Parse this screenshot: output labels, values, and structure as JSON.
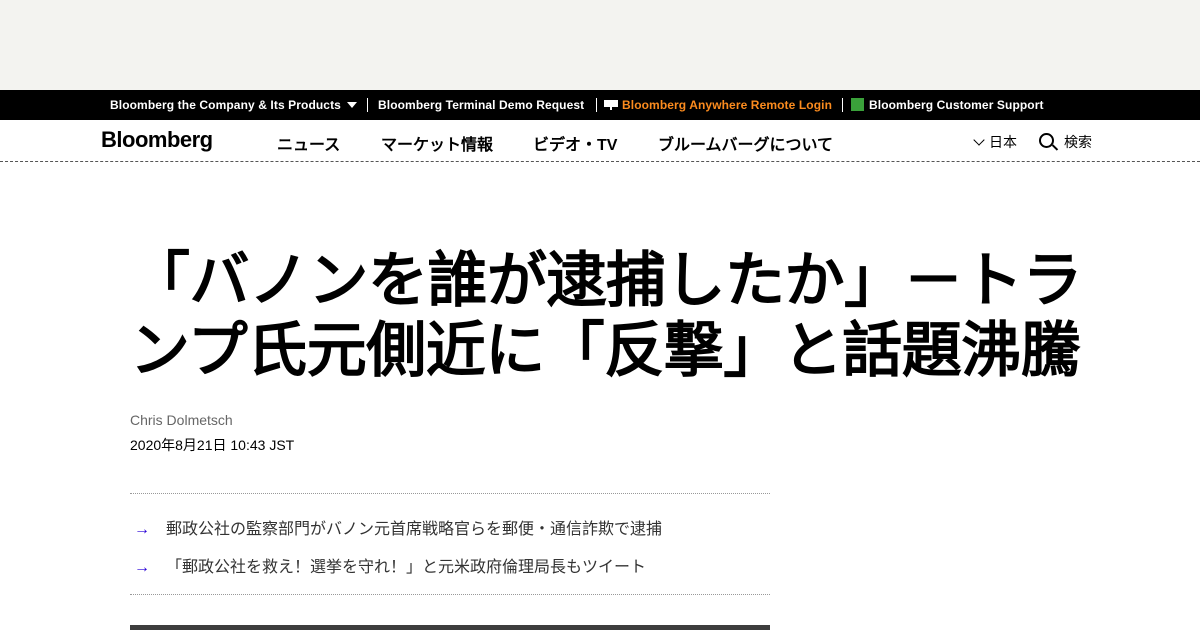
{
  "topbar": {
    "company": "Bloomberg the Company & Its Products",
    "terminal_demo": "Bloomberg Terminal Demo Request",
    "anywhere_login": "Bloomberg Anywhere Remote Login",
    "customer_support": "Bloomberg Customer Support",
    "accent_color": "#fb8b1e"
  },
  "nav": {
    "logo": "Bloomberg",
    "items": [
      "ニュース",
      "マーケット情報",
      "ビデオ・TV",
      "ブルームバーグについて"
    ],
    "region": "日本",
    "search": "検索"
  },
  "article": {
    "headline": "「バノンを誰が逮捕したか」－トランプ氏元側近に「反撃」と話題沸騰",
    "author": "Chris Dolmetsch",
    "date": "2020年8月21日 10:43 JST",
    "summary": [
      "郵政公社の監察部門がバノン元首席戦略官らを郵便・通信詐欺で逮捕",
      "「郵政公社を救え！選挙を守れ！」と元米政府倫理局長もツイート"
    ],
    "bullet_color": "#2800d7"
  },
  "icons": {
    "company_caret": "caret-down-icon",
    "anywhere": "monitor-icon",
    "support": "help-icon",
    "region": "chevron-down-icon",
    "search": "search-icon",
    "bullet": "arrow-right-icon"
  }
}
